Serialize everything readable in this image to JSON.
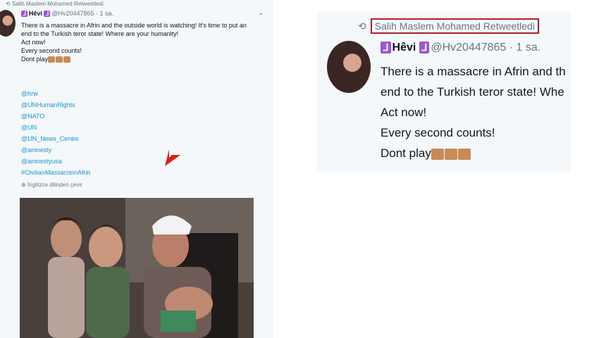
{
  "left_tweet": {
    "retweet_label": "Salih Maslem Mohamed Retweetledi",
    "display_name": "Hêvi",
    "handle": "@Hv20447865",
    "time": "· 1 sa.",
    "text_lines": [
      "There is a massacre in Afrin and the outside world is watching! It's time to put an",
      "end to the Turkish teror state! Where are your humanity!",
      "Act now!",
      "Every second counts!",
      "Dont play"
    ],
    "mentions": [
      "@hrw",
      "@UNHumanRights",
      "@NATO",
      "@UN",
      "@UN_News_Centre",
      "@amnesty",
      "@amnestyusa",
      "#CivilianMassacreinAfrin"
    ],
    "translate_label": "İngilizce dilinden çevir"
  },
  "right_tweet": {
    "retweet_label": "Salih Maslem Mohamed Retweetledi",
    "display_name": "Hêvi",
    "handle": "@Hv20447865",
    "time": "· 1 sa.",
    "text_lines": [
      "There is a massacre in Afrin and th",
      "end to the Turkish teror state! Whe",
      "Act now!",
      "Every second counts!",
      "Dont play"
    ]
  },
  "colors": {
    "highlight_box": "#b11f2b",
    "arrow": "#e0201b",
    "link": "#1b95e0",
    "badge": "#9b59d0"
  }
}
